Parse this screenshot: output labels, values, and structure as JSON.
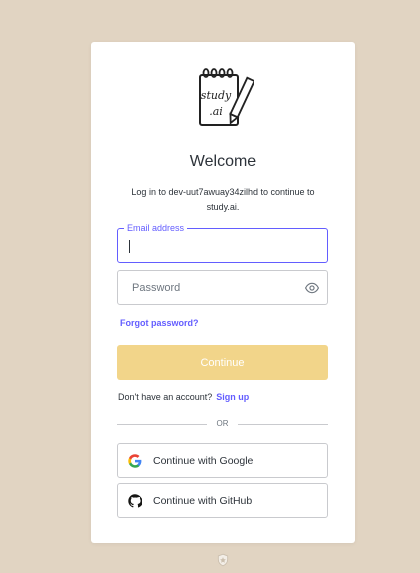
{
  "login": {
    "title": "Welcome",
    "subtitle": "Log in to dev-uut7awuay34zilhd to continue to study.ai.",
    "email": {
      "label": "Email address",
      "value": ""
    },
    "password": {
      "placeholder": "Password"
    },
    "forgot_label": "Forgot password?",
    "continue_label": "Continue",
    "signup_prompt": "Don't have an account?",
    "signup_label": "Sign up",
    "divider_label": "OR",
    "google_label": "Continue with Google",
    "github_label": "Continue with GitHub"
  },
  "logo_text": {
    "line1": "study",
    "line2": ".ai"
  },
  "colors": {
    "background": "#e1d4c2",
    "accent": "#635dff",
    "continue_button": "#f2d58a"
  },
  "icons": [
    "study-ai-logo",
    "eye-icon",
    "google-icon",
    "github-icon",
    "shield-icon"
  ]
}
